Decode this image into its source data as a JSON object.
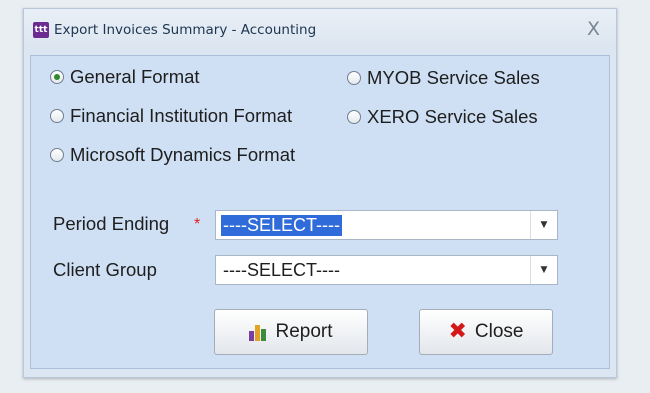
{
  "window": {
    "app_icon_text": "ttt",
    "title": "Export Invoices Summary - Accounting",
    "close_glyph": "X"
  },
  "formats": [
    {
      "label": "General Format",
      "checked": true
    },
    {
      "label": "Financial Institution Format",
      "checked": false
    },
    {
      "label": "Microsoft Dynamics Format",
      "checked": false
    },
    {
      "label": "MYOB Service Sales",
      "checked": false
    },
    {
      "label": "XERO Service Sales",
      "checked": false
    }
  ],
  "form": {
    "period_ending_label": "Period Ending",
    "required_marker": "*",
    "period_ending_value": "----SELECT----",
    "client_group_label": "Client Group",
    "client_group_value": "----SELECT----"
  },
  "buttons": {
    "report_label": "Report",
    "close_label": "Close"
  },
  "colors": {
    "accent_highlight": "#2f6bd9",
    "required": "#e02020",
    "close_icon": "#d21818"
  },
  "icons": {
    "app": "app-logo-icon",
    "report": "report-chart-icon",
    "close": "close-x-icon"
  }
}
